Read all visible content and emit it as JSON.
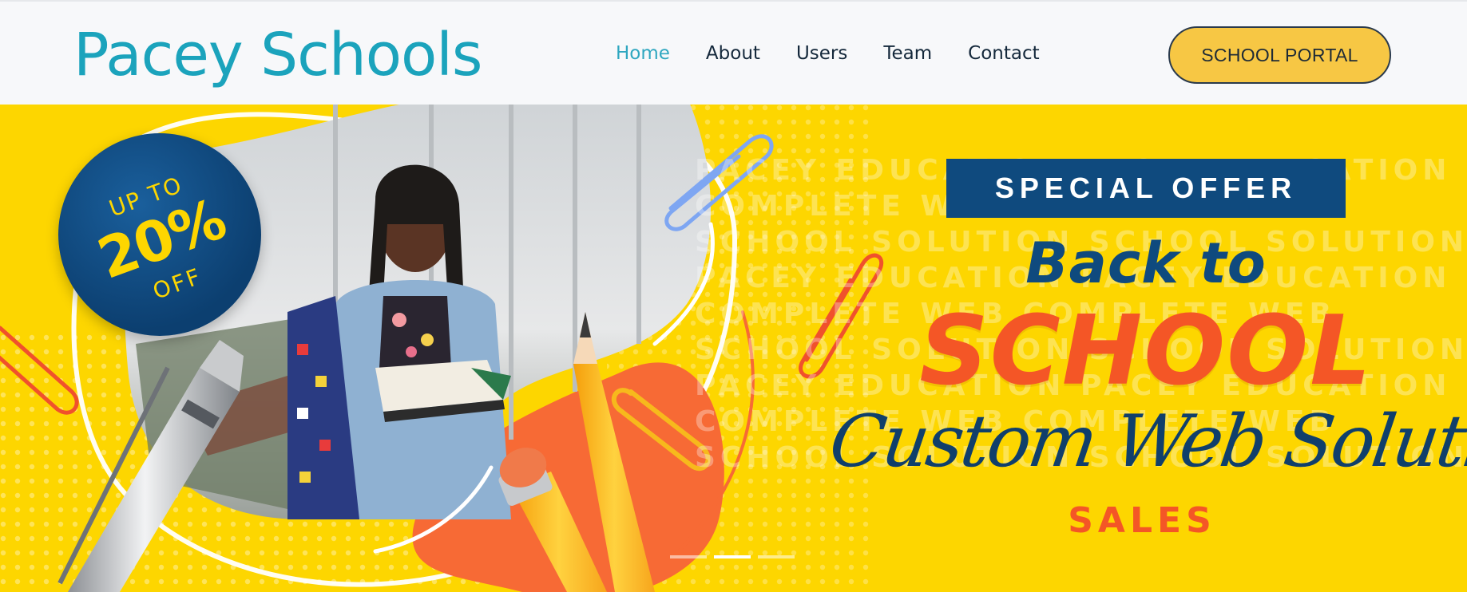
{
  "header": {
    "brand": "Pacey Schools",
    "nav": [
      {
        "label": "Home",
        "active": true
      },
      {
        "label": "About",
        "active": false
      },
      {
        "label": "Users",
        "active": false
      },
      {
        "label": "Team",
        "active": false
      },
      {
        "label": "Contact",
        "active": false
      }
    ],
    "portal_button": "SCHOOL PORTAL"
  },
  "hero": {
    "badge": {
      "top": "UP TO",
      "main": "20%",
      "bottom": "OFF"
    },
    "offer": "SPECIAL OFFER",
    "headline_line1": "Back to",
    "headline_line2": "SCHOOL",
    "script": "Custom Web Solution",
    "sales": "SALES",
    "watermark_lines": [
      "PACEY EDUCATION   PACEY EDUCATION",
      "COMPLETE WEB   COMPLETE WEB",
      "SCHOOL SOLUTION   SCHOOL SOLUTION",
      "PACEY EDUCATION   PACEY EDUCATION",
      "COMPLETE WEB   COMPLETE WEB",
      "SCHOOL SOLUTION   SCHOOL SOLUTION",
      "PACEY EDUCATION   PACEY EDUCATION",
      "COMPLETE WEB   COMPLETE WEB",
      "SCHOOL SOLUTION   SCHOOL SOLUTION"
    ],
    "slides": {
      "count": 3,
      "active": 2
    }
  },
  "colors": {
    "brand": "#1ba3bc",
    "nav_active": "#2fa7c0",
    "nav_text": "#14283b",
    "portal_button_bg": "#f7c744",
    "hero_bg": "#fdd600",
    "navy": "#0f4a7e",
    "orange": "#f45626"
  },
  "icons": [
    "paperclip-icon",
    "pencil-icon",
    "pen-icon"
  ]
}
